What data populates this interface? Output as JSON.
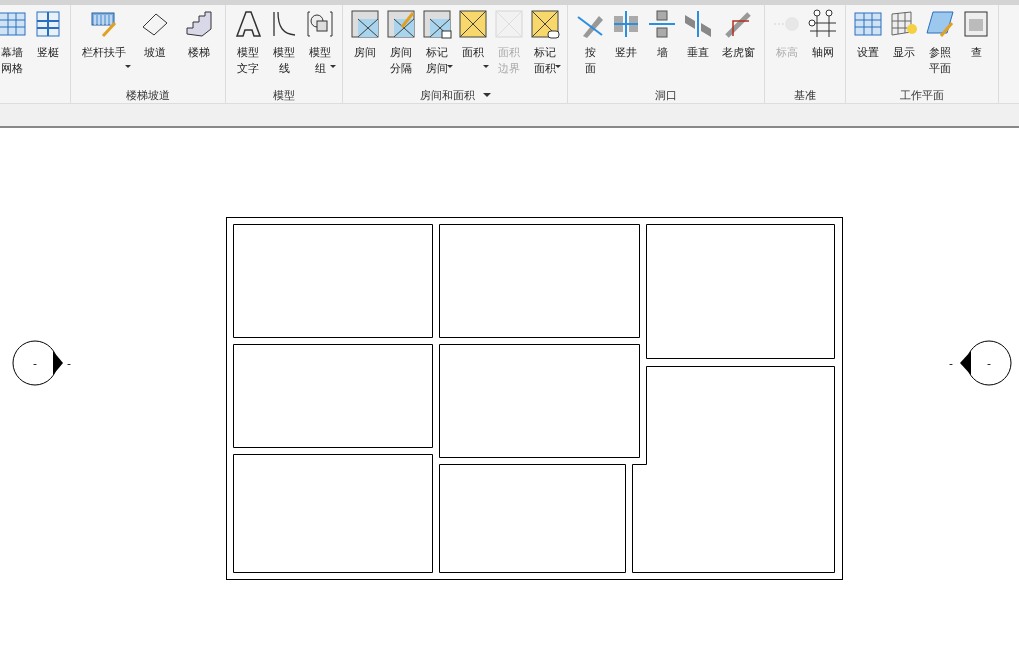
{
  "ribbon": {
    "panels": [
      {
        "menu": false,
        "buttons": [
          {
            "lines": [
              "幕墙",
              "网格"
            ],
            "disabled": false,
            "dropdown": false
          },
          {
            "lines": [
              "竖梃"
            ],
            "disabled": false,
            "dropdown": false
          }
        ]
      },
      {
        "label": "楼梯坡道",
        "menu": false,
        "buttons": [
          {
            "lines": [
              "栏杆扶手"
            ],
            "disabled": false,
            "dropdown": true
          },
          {
            "lines": [
              "坡道"
            ],
            "disabled": false,
            "dropdown": false
          },
          {
            "lines": [
              "楼梯"
            ],
            "disabled": false,
            "dropdown": false
          }
        ]
      },
      {
        "label": "模型",
        "menu": false,
        "buttons": [
          {
            "lines": [
              "模型",
              "文字"
            ],
            "disabled": false,
            "dropdown": false
          },
          {
            "lines": [
              "模型",
              "线"
            ],
            "disabled": false,
            "dropdown": false
          },
          {
            "lines": [
              "模型",
              "组"
            ],
            "disabled": false,
            "dropdown": true
          }
        ]
      },
      {
        "label": "房间和面积",
        "menu": true,
        "buttons": [
          {
            "lines": [
              "房间"
            ],
            "disabled": false,
            "dropdown": false
          },
          {
            "lines": [
              "房间",
              "分隔"
            ],
            "disabled": false,
            "dropdown": false
          },
          {
            "lines": [
              "标记",
              "房间"
            ],
            "disabled": false,
            "dropdown": true
          },
          {
            "lines": [
              "面积"
            ],
            "disabled": false,
            "dropdown": true
          },
          {
            "lines": [
              "面积",
              "边界"
            ],
            "disabled": true,
            "dropdown": false
          },
          {
            "lines": [
              "标记",
              "面积"
            ],
            "disabled": false,
            "dropdown": true
          }
        ]
      },
      {
        "label": "洞口",
        "menu": false,
        "buttons": [
          {
            "lines": [
              "按",
              "面"
            ],
            "disabled": false,
            "dropdown": false
          },
          {
            "lines": [
              "竖井"
            ],
            "disabled": false,
            "dropdown": false
          },
          {
            "lines": [
              "墙"
            ],
            "disabled": false,
            "dropdown": false
          },
          {
            "lines": [
              "垂直"
            ],
            "disabled": false,
            "dropdown": false
          },
          {
            "lines": [
              "老虎窗"
            ],
            "disabled": false,
            "dropdown": false
          }
        ]
      },
      {
        "label": "基准",
        "menu": false,
        "buttons": [
          {
            "lines": [
              "标高"
            ],
            "disabled": true,
            "dropdown": false
          },
          {
            "lines": [
              "轴网"
            ],
            "disabled": false,
            "dropdown": false
          }
        ]
      },
      {
        "label": "工作平面",
        "menu": false,
        "buttons": [
          {
            "lines": [
              "设置"
            ],
            "disabled": false,
            "dropdown": false
          },
          {
            "lines": [
              "显示"
            ],
            "disabled": false,
            "dropdown": false
          },
          {
            "lines": [
              "参照",
              "平面"
            ],
            "disabled": false,
            "dropdown": false
          },
          {
            "lines": [
              "查"
            ],
            "disabled": false,
            "dropdown": false
          }
        ]
      }
    ]
  },
  "markers": [
    {
      "labels": [
        "-",
        "-"
      ]
    },
    {
      "labels": [
        "-",
        "-"
      ]
    }
  ]
}
